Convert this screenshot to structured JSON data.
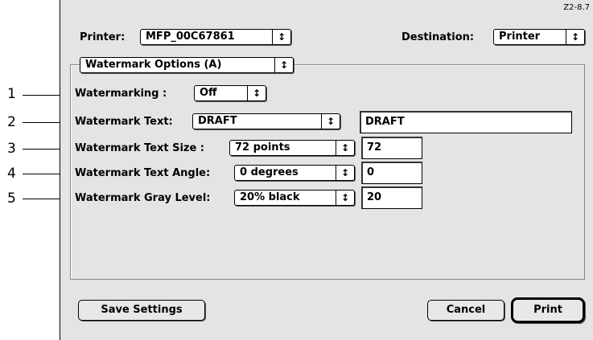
{
  "version": "Z2-8.7",
  "printer": {
    "label": "Printer:",
    "value": "MFP_00C67861"
  },
  "destination": {
    "label": "Destination:",
    "value": "Printer"
  },
  "panel": {
    "value": "Watermark Options (A)"
  },
  "rows": [
    {
      "callout": "1",
      "label": "Watermarking  :",
      "popup": "Off"
    },
    {
      "callout": "2",
      "label": "Watermark Text:",
      "popup": "DRAFT",
      "field": "DRAFT"
    },
    {
      "callout": "3",
      "label": "Watermark Text Size  :",
      "popup": "72 points",
      "field": "72"
    },
    {
      "callout": "4",
      "label": "Watermark Text Angle:",
      "popup": "0 degrees",
      "field": "0"
    },
    {
      "callout": "5",
      "label": "Watermark Gray Level:",
      "popup": "20% black",
      "field": "20"
    }
  ],
  "buttons": {
    "save": "Save Settings",
    "cancel": "Cancel",
    "print": "Print"
  },
  "icons": {
    "popup_arrow": "up-down-arrows-icon"
  }
}
